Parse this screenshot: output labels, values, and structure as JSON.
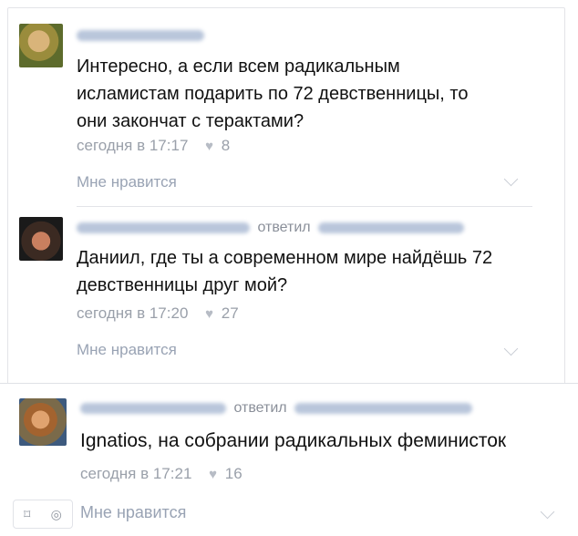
{
  "comments": [
    {
      "author": "",
      "reply_word": "",
      "reply_to": "",
      "text": "Интересно, а если всем радикальным\nисламистам подарить по 72 девственницы, то\nони закончат с терактами?",
      "timestamp": "сегодня в 17:17",
      "likes": "8",
      "like_label": "Мне нравится"
    },
    {
      "author": "",
      "reply_word": "ответил",
      "reply_to": "",
      "text": "Даниил, где ты а современном мире найдёшь 72\nдевственницы друг мой?",
      "timestamp": "сегодня в 17:20",
      "likes": "27",
      "like_label": "Мне нравится"
    },
    {
      "author": "",
      "reply_word": "ответил",
      "reply_to": "",
      "text": "Ignatios, на собрании радикальных феминисток",
      "timestamp": "сегодня в 17:21",
      "likes": "16",
      "like_label": "Мне нравится"
    }
  ],
  "icons": {
    "heart": "heart-icon",
    "chevron": "chevron-down-icon",
    "bookmark": "bookmark-icon",
    "camera": "camera-icon"
  },
  "colors": {
    "link": "#5b6e8a",
    "meta": "#9aa0aa",
    "text": "#111111"
  }
}
